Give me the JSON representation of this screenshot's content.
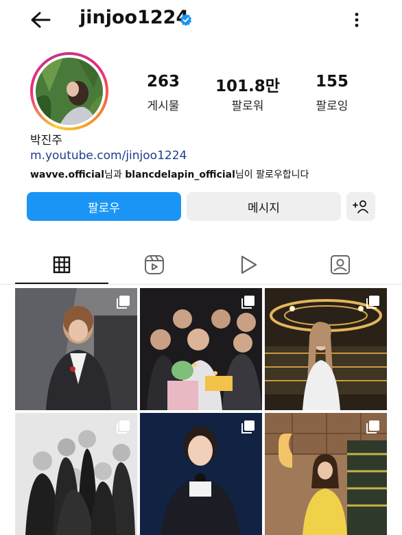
{
  "header": {
    "username": "jinjoo1224",
    "back_icon": "arrow-left-icon",
    "verified_icon": "verified-badge-icon",
    "menu_icon": "more-vertical-icon"
  },
  "profile": {
    "stats": [
      {
        "value": "263",
        "label": "게시물"
      },
      {
        "value": "101.8만",
        "label": "팔로워"
      },
      {
        "value": "155",
        "label": "팔로잉"
      }
    ],
    "name": "박진주",
    "link": "m.youtube.com/jinjoo1224",
    "followed_by": {
      "user1": "wavve.official",
      "sep1": "님과 ",
      "user2": "blancdelapin_official",
      "suffix": "님이 팔로우합니다"
    }
  },
  "actions": {
    "follow_label": "팔로우",
    "message_label": "메시지",
    "add_user_label": "+ዾ"
  },
  "tabs": [
    {
      "name": "grid",
      "icon": "grid-icon"
    },
    {
      "name": "reels",
      "icon": "reels-icon"
    },
    {
      "name": "video",
      "icon": "play-icon"
    },
    {
      "name": "tagged",
      "icon": "tagged-user-icon"
    }
  ],
  "colors": {
    "accent": "#1a95f5",
    "text": "#111111",
    "link": "#1c3d8a"
  }
}
